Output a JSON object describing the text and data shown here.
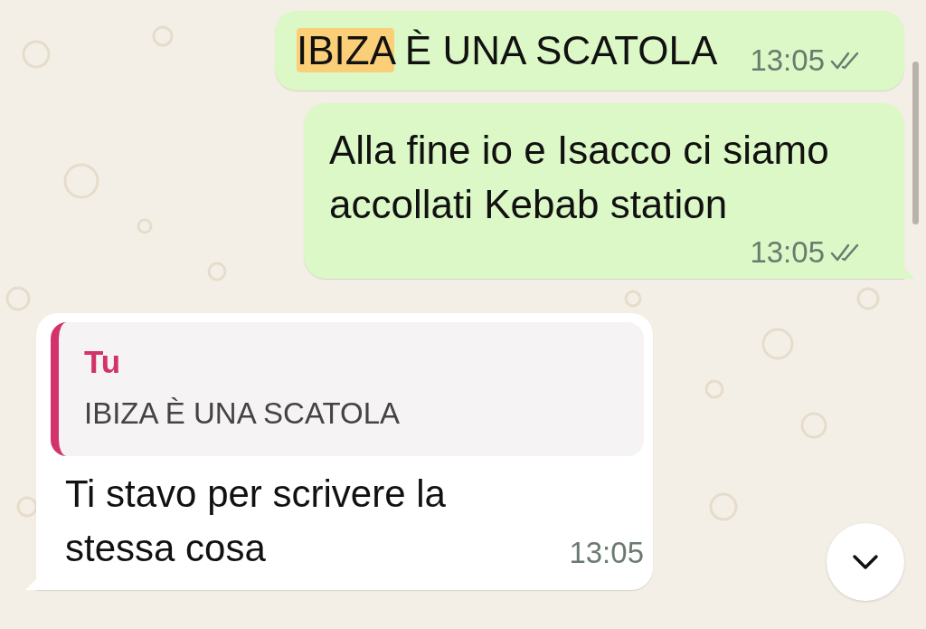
{
  "messages": [
    {
      "kind": "sent",
      "parts": [
        {
          "text": "IBIZA",
          "highlighted": true
        },
        {
          "text": " È UNA SCATOLA",
          "highlighted": false
        }
      ],
      "time": "13:05",
      "read": false,
      "tail": false
    },
    {
      "kind": "sent",
      "parts": [
        {
          "text": "Alla fine io e Isacco ci siamo accollati Kebab station",
          "highlighted": false
        }
      ],
      "time": "13:05",
      "read": false,
      "tail": true
    },
    {
      "kind": "received",
      "reply": {
        "author": "Tu",
        "text": "IBIZA È UNA SCATOLA"
      },
      "parts": [
        {
          "text": "Ti stavo per scrivere la stessa cosa",
          "highlighted": false
        }
      ],
      "time": "13:05",
      "tail": true
    }
  ]
}
